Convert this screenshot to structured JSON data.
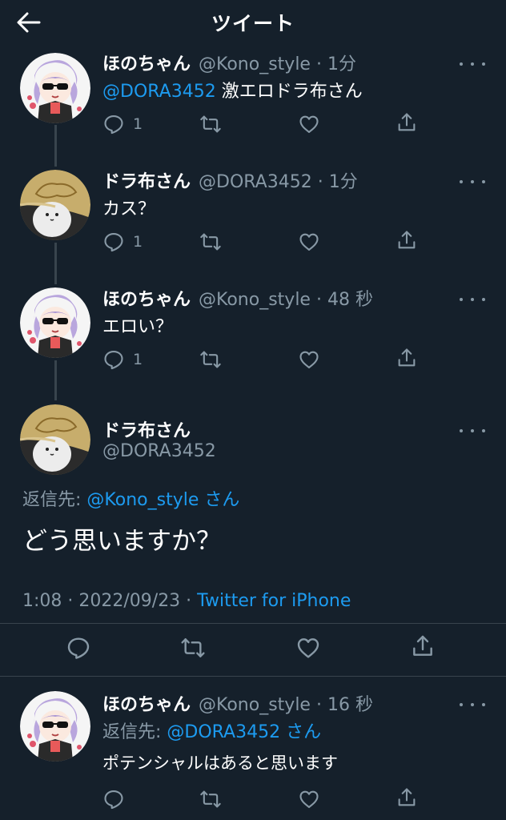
{
  "header": {
    "title": "ツイート"
  },
  "tweets": [
    {
      "name": "ほのちゃん",
      "handle": "@Kono_style",
      "sep": "·",
      "time": "1分",
      "mention": "@DORA3452",
      "body": " 激エロドラ布さん",
      "reply_count": "1"
    },
    {
      "name": "ドラ布さん",
      "handle": "@DORA3452",
      "sep": "·",
      "time": "1分",
      "body": "カス？",
      "reply_count": "1"
    },
    {
      "name": "ほのちゃん",
      "handle": "@Kono_style",
      "sep": "·",
      "time": "48 秒",
      "body": "エロい？",
      "reply_count": "1"
    }
  ],
  "main": {
    "name": "ドラ布さん",
    "handle": "@DORA3452",
    "reply_label": "返信先: ",
    "reply_to": "@Kono_style",
    "reply_suffix": " さん",
    "body": "どう思いますか？",
    "timestamp": "1:08 · 2022/09/23 · ",
    "source": "Twitter for iPhone"
  },
  "reply": {
    "name": "ほのちゃん",
    "handle": "@Kono_style",
    "sep": "·",
    "time": "16 秒",
    "reply_label": "返信先: ",
    "reply_to": "@DORA3452",
    "reply_suffix": " さん",
    "body": "ポテンシャルはあると思います"
  },
  "colors": {
    "background": "#15202b",
    "accent": "#1d9bf0",
    "muted": "#8899a6",
    "divider": "#38444d"
  },
  "icons": [
    "back-arrow-icon",
    "reply-icon",
    "retweet-icon",
    "like-icon",
    "share-icon",
    "more-icon"
  ]
}
